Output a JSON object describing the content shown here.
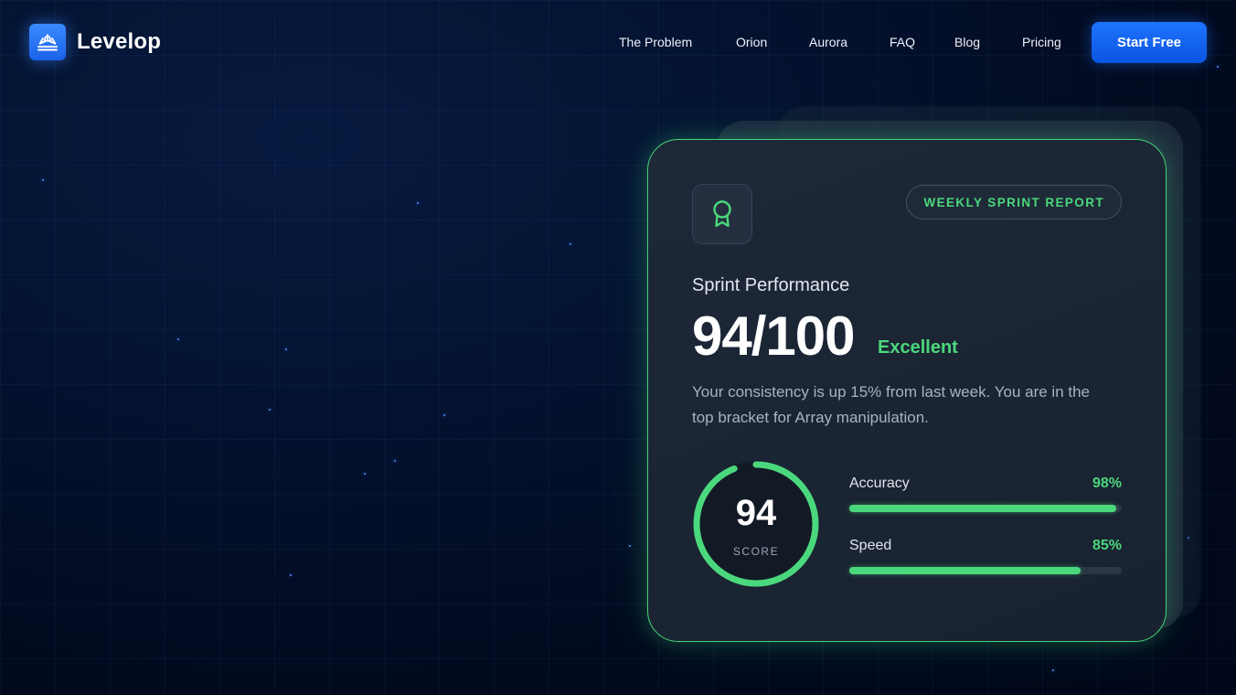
{
  "brand": {
    "name": "Levelop",
    "logo_icon": "sunrise-icon",
    "accent": "#1f74ff"
  },
  "nav": {
    "items": [
      {
        "label": "The Problem"
      },
      {
        "label": "Orion"
      },
      {
        "label": "Aurora"
      },
      {
        "label": "FAQ"
      },
      {
        "label": "Blog"
      },
      {
        "label": "Pricing"
      }
    ],
    "cta_label": "Start Free"
  },
  "card": {
    "icon": "award-ribbon-icon",
    "pill_label": "WEEKLY SPRINT REPORT",
    "title": "Sprint Performance",
    "score_text": "94/100",
    "rating": "Excellent",
    "description": "Your consistency is up 15% from last week. You are in the top bracket for Array manipulation.",
    "ring": {
      "value": "94",
      "label": "SCORE",
      "fraction": 0.94
    },
    "metrics": [
      {
        "name": "Accuracy",
        "value": "98%",
        "fraction": 0.98
      },
      {
        "name": "Speed",
        "value": "85%",
        "fraction": 0.85
      }
    ],
    "success_color": "#4bd87c"
  }
}
